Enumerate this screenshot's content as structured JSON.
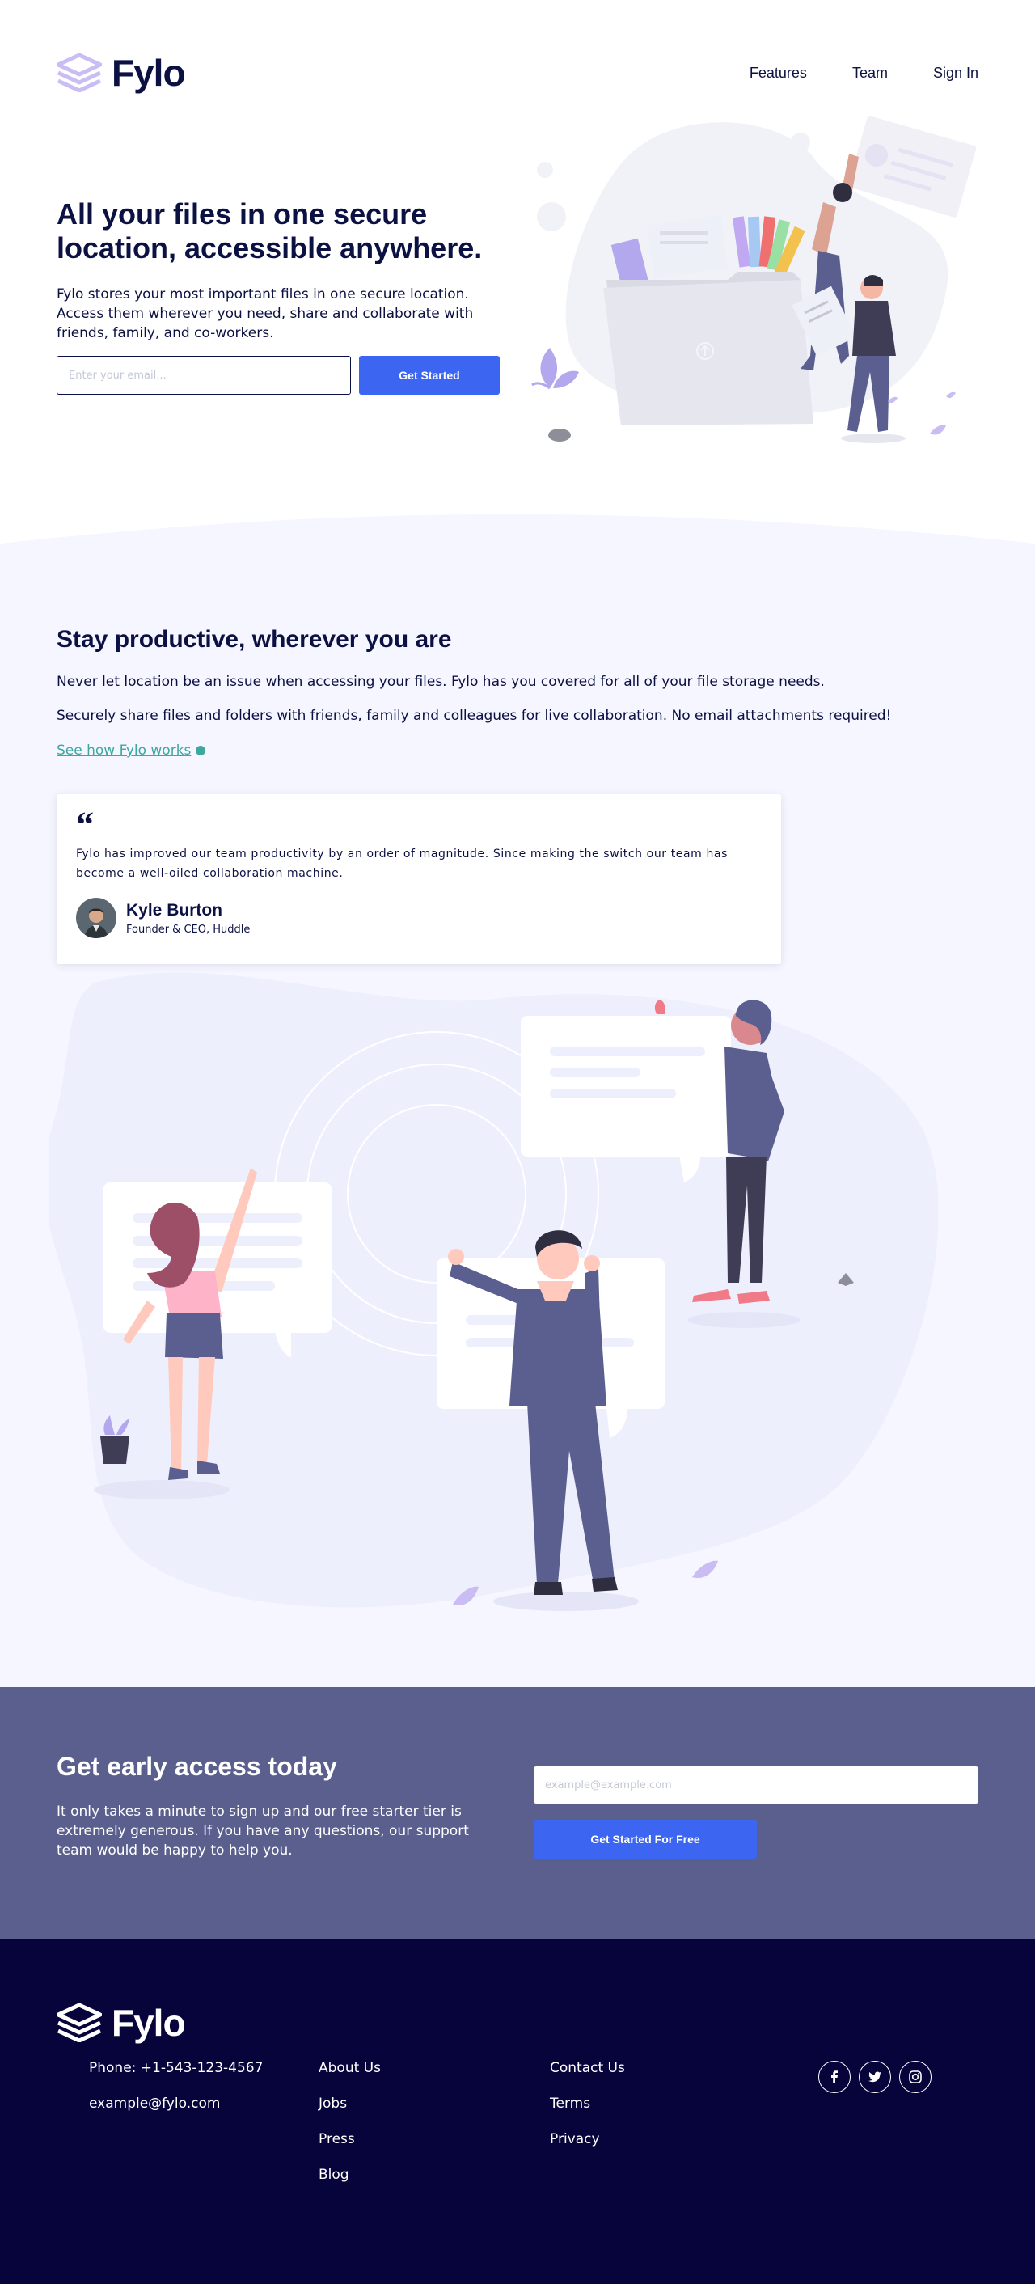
{
  "brand": {
    "name": "Fylo"
  },
  "nav": {
    "features": "Features",
    "team": "Team",
    "signin": "Sign In"
  },
  "hero": {
    "title": "All your files in one secure location, accessible anywhere.",
    "description": "Fylo stores your most important files in one secure location. Access them wherever you need, share and collaborate with friends, family, and co-workers.",
    "email_placeholder": "Enter your email...",
    "cta_label": "Get Started"
  },
  "productive": {
    "title": "Stay productive, wherever you are",
    "paragraph1": "Never let location be an issue when accessing your files. Fylo has you covered for all of your file storage needs.",
    "paragraph2": "Securely share files and folders with friends, family and colleagues for live collaboration. No email attachments required!",
    "link_label": "See how Fylo works"
  },
  "testimonial": {
    "quote_mark": "“",
    "text": "Fylo has improved our team productivity by an order of magnitude. Since making the switch our team has become a well-oiled collaboration machine.",
    "name": "Kyle Burton",
    "role": "Founder & CEO, Huddle"
  },
  "early_access": {
    "title": "Get early access today",
    "description": "It only takes a minute to sign up and our free starter tier is extremely generous. If you have any questions, our support team would be happy to help you.",
    "email_placeholder": "example@example.com",
    "cta_label": "Get Started For Free"
  },
  "footer": {
    "contact": {
      "phone": "Phone: +1-543-123-4567",
      "email": "example@fylo.com"
    },
    "links_col1": [
      "About Us",
      "Jobs",
      "Press",
      "Blog"
    ],
    "links_col2": [
      "Contact Us",
      "Terms",
      "Privacy"
    ],
    "socials": [
      "facebook-icon",
      "twitter-icon",
      "instagram-icon"
    ]
  },
  "colors": {
    "primary_blue": "#3c66f2",
    "navy": "#0c1143",
    "teal_link": "#3ba99e",
    "cta_bg": "#5b5f8e",
    "footer_bg": "#07043b",
    "section_bg": "#f5f6ff"
  }
}
